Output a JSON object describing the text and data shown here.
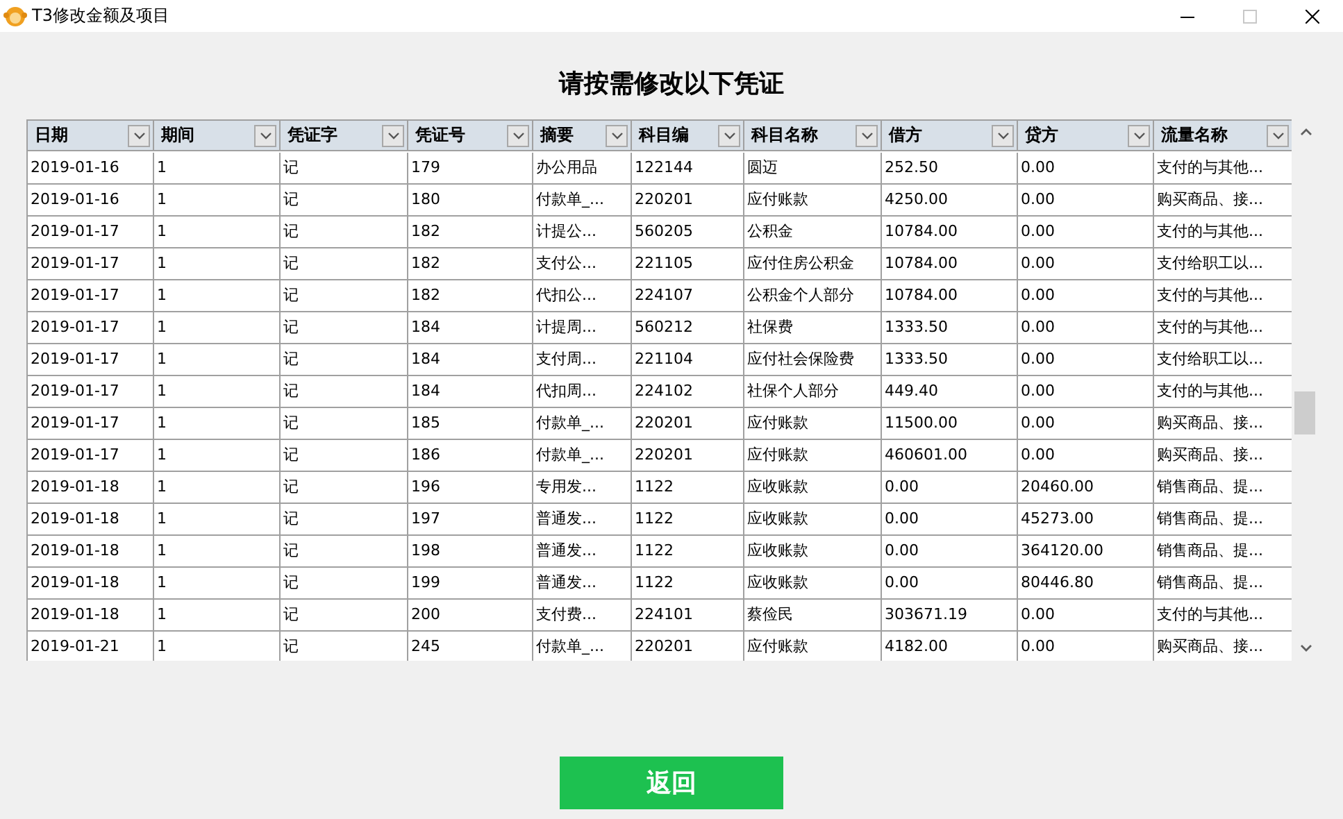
{
  "window": {
    "title": "T3修改金额及项目"
  },
  "heading": "请按需修改以下凭证",
  "table": {
    "columns": [
      "日期",
      "期间",
      "凭证字",
      "凭证号",
      "摘要",
      "科目编",
      "科目名称",
      "借方",
      "贷方",
      "流量名称"
    ],
    "rows": [
      [
        "2019-01-16",
        "1",
        "记",
        "179",
        "办公用品",
        "122144",
        "圆迈",
        "252.50",
        "0.00",
        "支付的与其他..."
      ],
      [
        "2019-01-16",
        "1",
        "记",
        "180",
        "付款单_...",
        "220201",
        "应付账款",
        "4250.00",
        "0.00",
        "购买商品、接..."
      ],
      [
        "2019-01-17",
        "1",
        "记",
        "182",
        "计提公...",
        "560205",
        "公积金",
        "10784.00",
        "0.00",
        "支付的与其他..."
      ],
      [
        "2019-01-17",
        "1",
        "记",
        "182",
        "支付公...",
        "221105",
        "应付住房公积金",
        "10784.00",
        "0.00",
        "支付给职工以..."
      ],
      [
        "2019-01-17",
        "1",
        "记",
        "182",
        "代扣公...",
        "224107",
        "公积金个人部分",
        "10784.00",
        "0.00",
        "支付的与其他..."
      ],
      [
        "2019-01-17",
        "1",
        "记",
        "184",
        "计提周...",
        "560212",
        "社保费",
        "1333.50",
        "0.00",
        "支付的与其他..."
      ],
      [
        "2019-01-17",
        "1",
        "记",
        "184",
        "支付周...",
        "221104",
        "应付社会保险费",
        "1333.50",
        "0.00",
        "支付给职工以..."
      ],
      [
        "2019-01-17",
        "1",
        "记",
        "184",
        "代扣周...",
        "224102",
        "社保个人部分",
        "449.40",
        "0.00",
        "支付的与其他..."
      ],
      [
        "2019-01-17",
        "1",
        "记",
        "185",
        "付款单_...",
        "220201",
        "应付账款",
        "11500.00",
        "0.00",
        "购买商品、接..."
      ],
      [
        "2019-01-17",
        "1",
        "记",
        "186",
        "付款单_...",
        "220201",
        "应付账款",
        "460601.00",
        "0.00",
        "购买商品、接..."
      ],
      [
        "2019-01-18",
        "1",
        "记",
        "196",
        "专用发...",
        "1122",
        "应收账款",
        "0.00",
        "20460.00",
        "销售商品、提..."
      ],
      [
        "2019-01-18",
        "1",
        "记",
        "197",
        "普通发...",
        "1122",
        "应收账款",
        "0.00",
        "45273.00",
        "销售商品、提..."
      ],
      [
        "2019-01-18",
        "1",
        "记",
        "198",
        "普通发...",
        "1122",
        "应收账款",
        "0.00",
        "364120.00",
        "销售商品、提..."
      ],
      [
        "2019-01-18",
        "1",
        "记",
        "199",
        "普通发...",
        "1122",
        "应收账款",
        "0.00",
        "80446.80",
        "销售商品、提..."
      ],
      [
        "2019-01-18",
        "1",
        "记",
        "200",
        "支付费...",
        "224101",
        "蔡俭民",
        "303671.19",
        "0.00",
        "支付的与其他..."
      ],
      [
        "2019-01-21",
        "1",
        "记",
        "245",
        "付款单_...",
        "220201",
        "应付账款",
        "4182.00",
        "0.00",
        "购买商品、接..."
      ]
    ]
  },
  "button": "返回"
}
